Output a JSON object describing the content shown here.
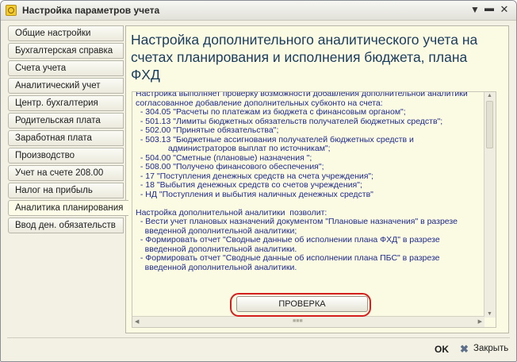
{
  "window": {
    "title": "Настройка параметров учета",
    "controls": [
      "menu-icon",
      "minimize-icon",
      "close-icon"
    ]
  },
  "sidebar": {
    "items": [
      {
        "label": "Общие настройки",
        "active": false
      },
      {
        "label": "Бухгалтерская справка",
        "active": false
      },
      {
        "label": "Счета учета",
        "active": false
      },
      {
        "label": "Аналитический учет",
        "active": false
      },
      {
        "label": "Центр. бухгалтерия",
        "active": false
      },
      {
        "label": "Родительская плата",
        "active": false
      },
      {
        "label": "Заработная плата",
        "active": false
      },
      {
        "label": "Производство",
        "active": false
      },
      {
        "label": "Учет на счете 208.00",
        "active": false
      },
      {
        "label": "Налог на прибыль",
        "active": false
      },
      {
        "label": "Аналитика планирования",
        "active": true
      },
      {
        "label": "Ввод ден. обязательств",
        "active": false
      }
    ]
  },
  "main": {
    "title": "Настройка дополнительного аналитического учета на счетах планирования и исполнения бюджета, плана ФХД",
    "description": "Настройка выполняет проверку возможности добавления дополнительной аналитики\nсогласованное добавление дополнительных субконто на счета:\n  - 304.05 \"Расчеты по платежам из бюджета с финансовым органом\";\n  - 501.13 \"Лимиты бюджетных обязательств получателей бюджетных средств\";\n  - 502.00 \"Принятые обязательства\";\n  - 503.13 \"Бюджетные ассигнования получателей бюджетных средств и\n              администраторов выплат по источникам\";\n  - 504.00 \"Сметные (плановые) назначения \";\n  - 508.00 \"Получено финансового обеспечения\";\n  - 17 \"Поступления денежных средств на счета учреждения\";\n  - 18 \"Выбытия денежных средств со счетов учреждения\";\n  - НД \"Поступления и выбытия наличных денежных средств\"\n\nНастройка дополнительной аналитики  позволит:\n  - Вести учет плановых назначений документом \"Плановые назначения\" в разрезе\n    введенной дополнительной аналитики;\n  - Формировать отчет \"Сводные данные об исполнении плана ФХД\" в разрезе\n    введенной дополнительной аналитики.\n  - Формировать отчет \"Сводные данные об исполнении плана ПБС\" в разрезе\n    введенной дополнительной аналитики.",
    "check_button": "ПРОВЕРКА",
    "highlight_color": "#d41f1f"
  },
  "footer": {
    "ok_label": "OK",
    "close_label": "Закрыть",
    "close_icon": "x-icon"
  },
  "colors": {
    "panel_background": "#fbfae3",
    "title_text": "#1a3c5c",
    "body_text": "#1e2a8a"
  }
}
